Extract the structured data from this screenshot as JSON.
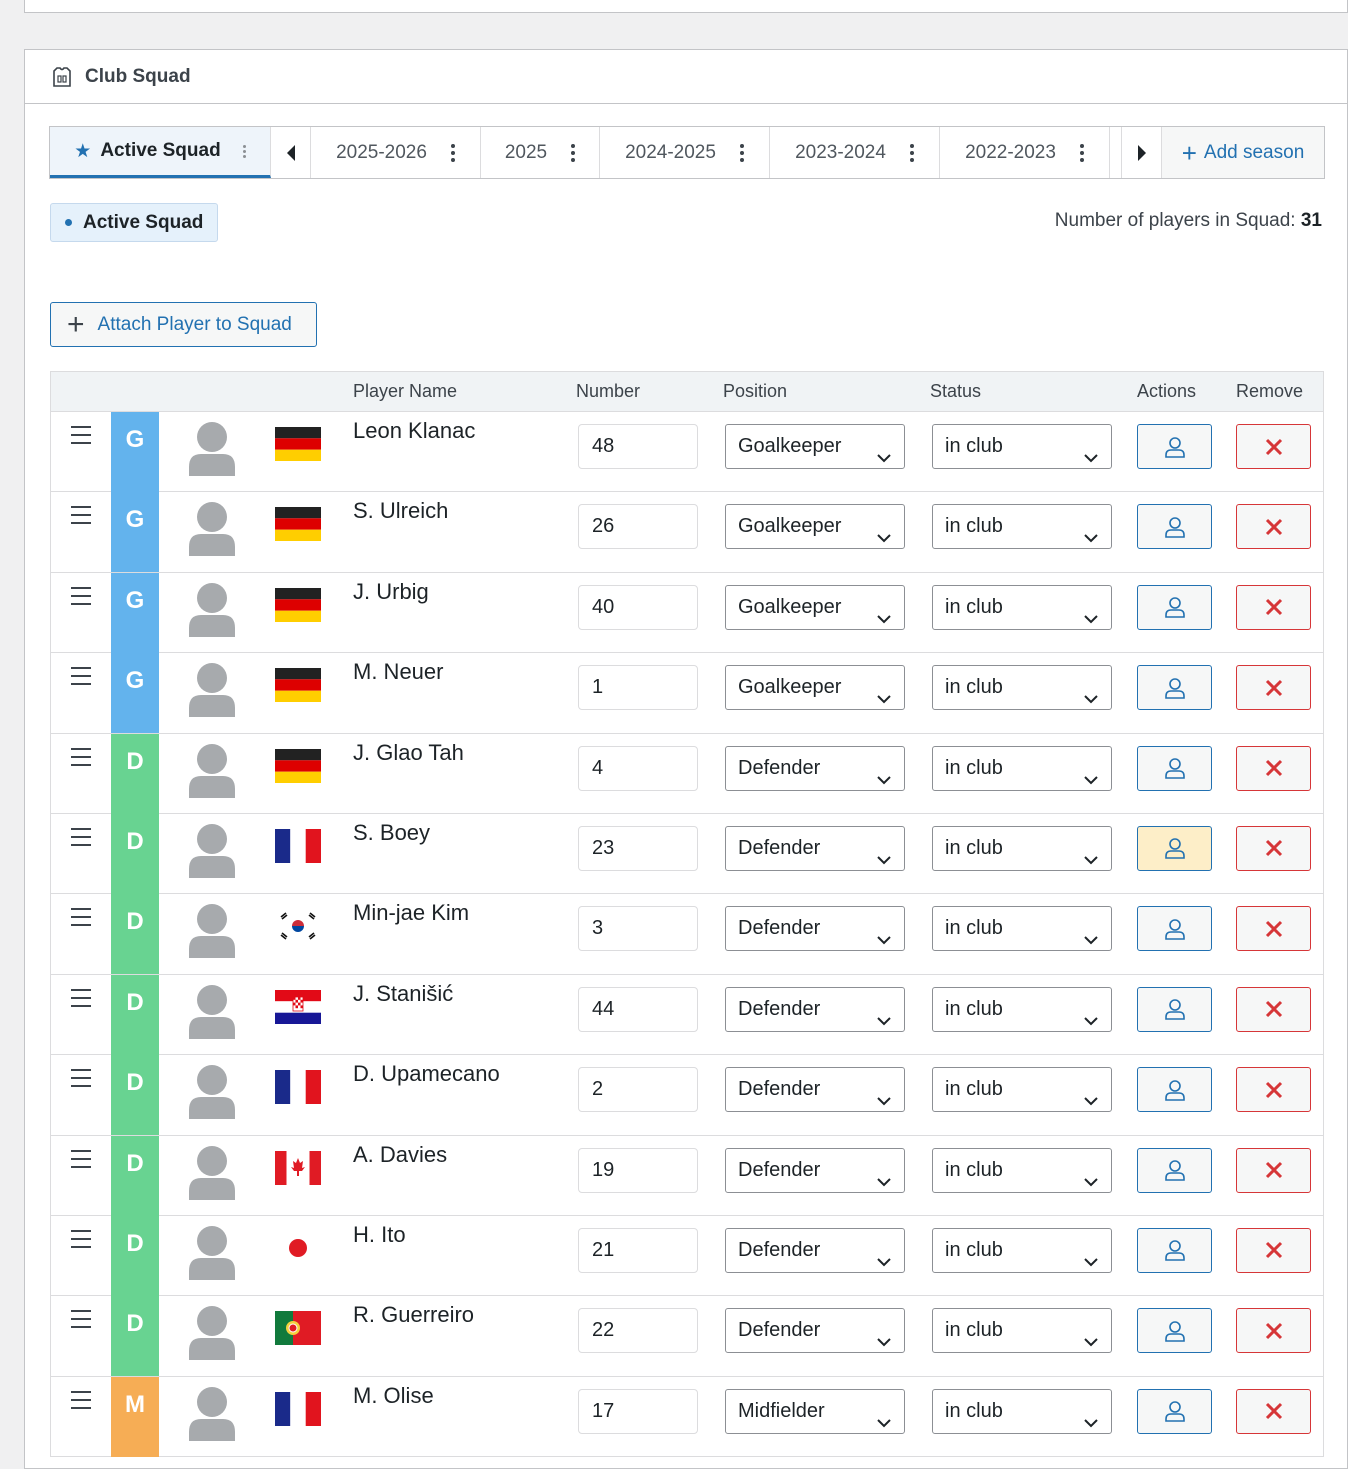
{
  "panel": {
    "title": "Club Squad",
    "icon": "jersey-icon"
  },
  "tabs": {
    "active": {
      "label": "Active Squad",
      "icon": "star-icon"
    },
    "seasons": [
      "2025-2026",
      "2025",
      "2024-2025",
      "2023-2024",
      "2022-2023"
    ],
    "add_season": "Add season"
  },
  "squad_badge": "Active Squad",
  "player_count": {
    "label": "Number of players in Squad:",
    "value": "31"
  },
  "attach_button": "Attach Player to Squad",
  "table": {
    "headers": {
      "player_name": "Player Name",
      "number": "Number",
      "position": "Position",
      "status": "Status",
      "actions": "Actions",
      "remove": "Remove"
    },
    "rows": [
      {
        "pos": "G",
        "name": "Leon Klanac",
        "number": "48",
        "position": "Goalkeeper",
        "status": "in club",
        "flag": "germany"
      },
      {
        "pos": "G",
        "name": "S. Ulreich",
        "number": "26",
        "position": "Goalkeeper",
        "status": "in club",
        "flag": "germany"
      },
      {
        "pos": "G",
        "name": "J. Urbig",
        "number": "40",
        "position": "Goalkeeper",
        "status": "in club",
        "flag": "germany"
      },
      {
        "pos": "G",
        "name": "M. Neuer",
        "number": "1",
        "position": "Goalkeeper",
        "status": "in club",
        "flag": "germany"
      },
      {
        "pos": "D",
        "name": "J. Glao Tah",
        "number": "4",
        "position": "Defender",
        "status": "in club",
        "flag": "germany"
      },
      {
        "pos": "D",
        "name": "S. Boey",
        "number": "23",
        "position": "Defender",
        "status": "in club",
        "flag": "france",
        "highlight": true
      },
      {
        "pos": "D",
        "name": "Min-jae Kim",
        "number": "3",
        "position": "Defender",
        "status": "in club",
        "flag": "south-korea"
      },
      {
        "pos": "D",
        "name": "J. Stanišić",
        "number": "44",
        "position": "Defender",
        "status": "in club",
        "flag": "croatia"
      },
      {
        "pos": "D",
        "name": "D. Upamecano",
        "number": "2",
        "position": "Defender",
        "status": "in club",
        "flag": "france"
      },
      {
        "pos": "D",
        "name": "A. Davies",
        "number": "19",
        "position": "Defender",
        "status": "in club",
        "flag": "canada"
      },
      {
        "pos": "D",
        "name": "H. Ito",
        "number": "21",
        "position": "Defender",
        "status": "in club",
        "flag": "japan"
      },
      {
        "pos": "D",
        "name": "R. Guerreiro",
        "number": "22",
        "position": "Defender",
        "status": "in club",
        "flag": "portugal"
      },
      {
        "pos": "M",
        "name": "M. Olise",
        "number": "17",
        "position": "Midfielder",
        "status": "in club",
        "flag": "france"
      }
    ]
  },
  "colors": {
    "accent": "#2271b1",
    "goalkeeper": "#63b3ed",
    "defender": "#68d391",
    "midfielder": "#f6ad55",
    "remove": "#d63638",
    "highlight_action": "#fdeec8"
  }
}
